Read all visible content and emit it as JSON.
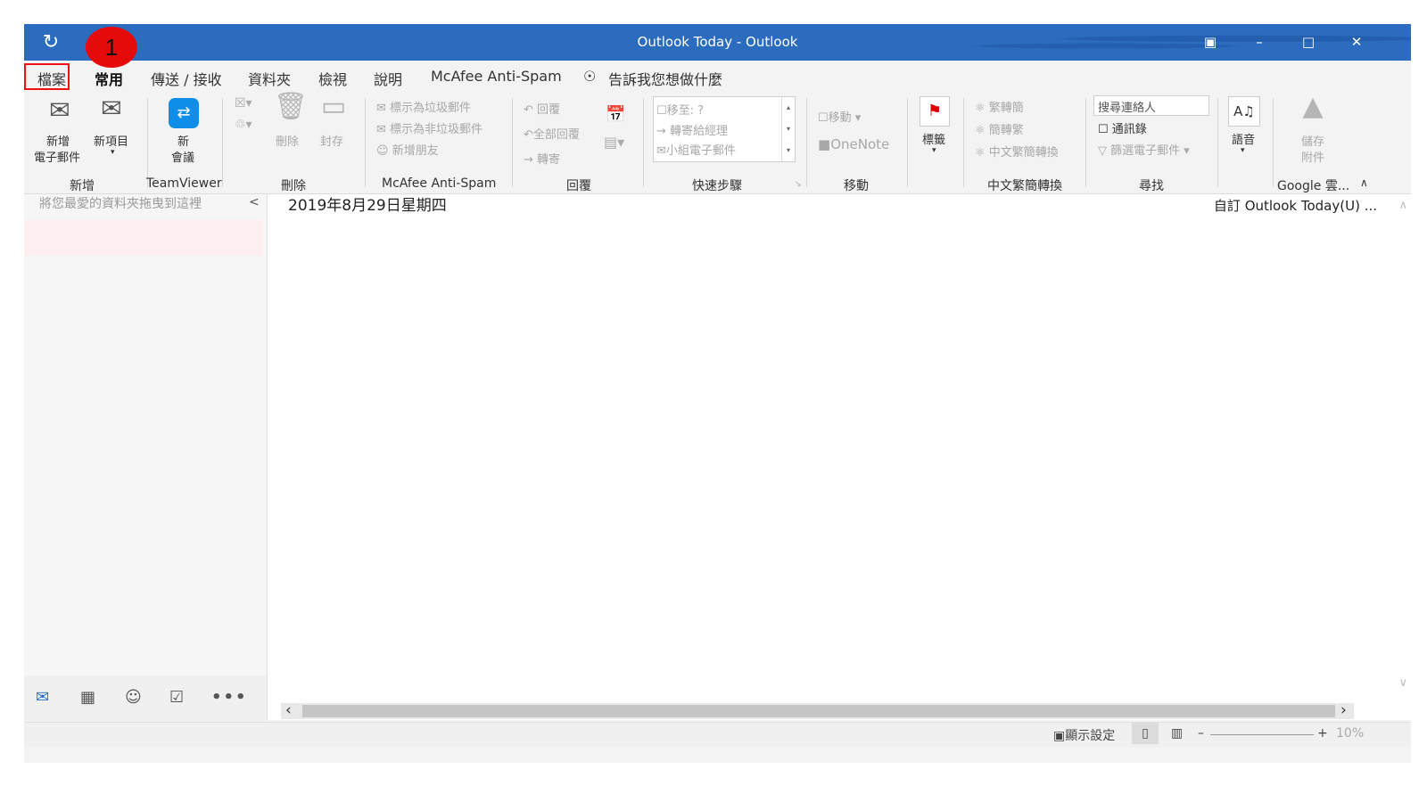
{
  "window": {
    "title": "Outlook Today - Outlook",
    "badge": "1"
  },
  "tabs": [
    "檔案",
    "常用",
    "傳送 / 接收",
    "資料夾",
    "檢視",
    "說明",
    "McAfee Anti-Spam",
    "告訴我您想做什麼"
  ],
  "ribbon": {
    "new_mail": [
      "新增",
      "電子郵件"
    ],
    "new_items": "新項目",
    "teamviewer_btn": [
      "新",
      "會議"
    ],
    "delete_btn": "刪除",
    "archive_btn": "封存",
    "mark_junk": "標示為垃圾郵件",
    "mark_not_junk": "標示為非垃圾郵件",
    "add_friend": "新增朋友",
    "reply": "回覆",
    "reply_all": "全部回覆",
    "forward": "轉寄",
    "qs_move_to": "移至: ?",
    "qs_to_manager": "轉寄給經理",
    "qs_team_mail": "小組電子郵件",
    "move_btn": "移動",
    "onenote": "OneNote",
    "tags_btn": "標籤",
    "trad_to_simp": "繁轉簡",
    "simp_to_trad": "簡轉繁",
    "chinese_conversion": "中文繁簡轉換",
    "search_contacts": "搜尋連絡人",
    "address_book": "通訊錄",
    "filter_mail": "篩選電子郵件",
    "speech": "語音",
    "save_attach": [
      "儲存",
      "附件"
    ],
    "groups": {
      "new": "新增",
      "teamviewer": "TeamViewer",
      "delete": "刪除",
      "mcafee": "McAfee Anti-Spam",
      "respond": "回覆",
      "quicksteps": "快速步驟",
      "move": "移動",
      "conversion": "中文繁簡轉換",
      "find": "尋找",
      "google": "Google 雲..."
    }
  },
  "navpane": {
    "favorites_hint": "將您最愛的資料夾拖曳到這裡",
    "collapse": "<"
  },
  "content": {
    "date": "2019年8月29日星期四",
    "customize": "自訂 Outlook Today(U) ..."
  },
  "status": {
    "display_settings": "顯示設定",
    "zoom": "10%"
  },
  "colors": {
    "titlebar": "#2b6cbf",
    "badge": "#e60b0b",
    "highlight_box": "#ee1111"
  }
}
